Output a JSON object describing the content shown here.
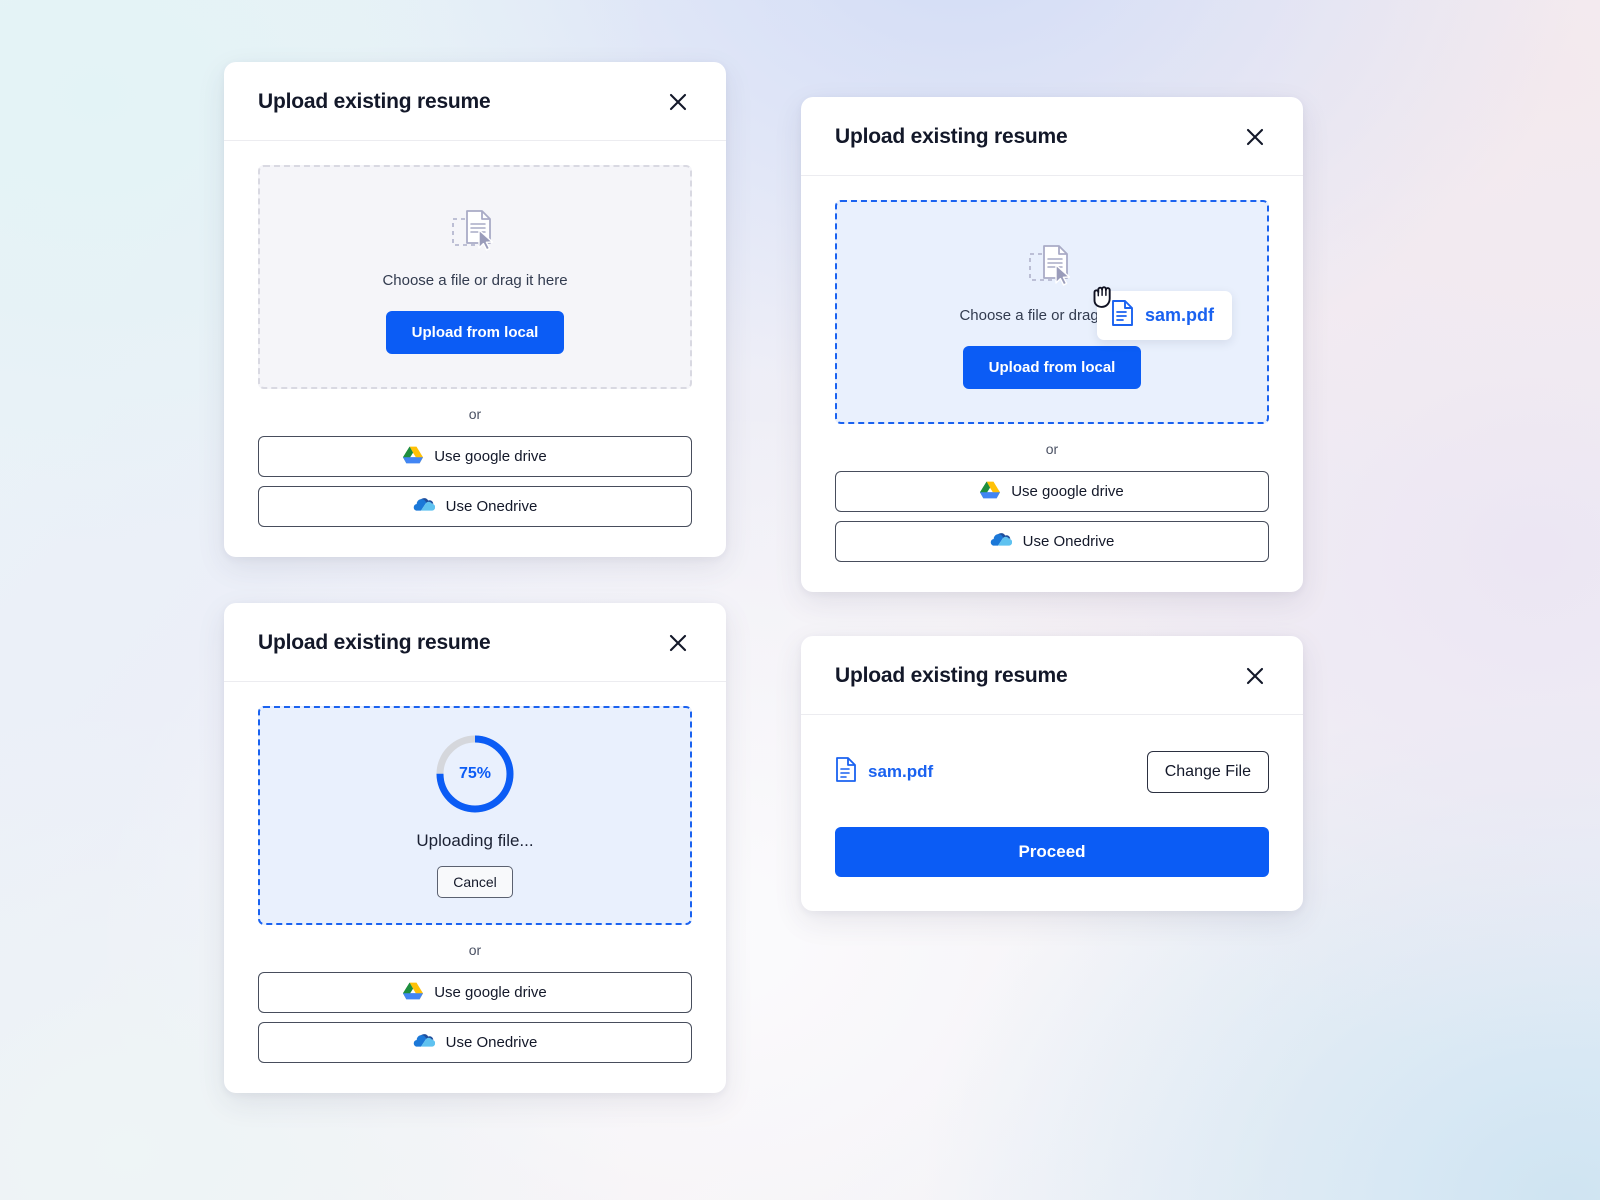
{
  "cards": {
    "initial": {
      "title": "Upload existing resume",
      "close_icon": "close-icon",
      "dropzone": {
        "icon": "file-drag-icon",
        "hint": "Choose a file or drag it here",
        "upload_button": "Upload from local",
        "state": "idle"
      },
      "separator": "or",
      "providers": [
        {
          "icon": "google-drive-icon",
          "label": "Use google drive"
        },
        {
          "icon": "onedrive-icon",
          "label": "Use Onedrive"
        }
      ]
    },
    "dragging": {
      "title": "Upload existing resume",
      "close_icon": "close-icon",
      "dropzone": {
        "icon": "file-drag-icon",
        "hint": "Choose a file or drag it here",
        "upload_button": "Upload from local",
        "state": "drag-active"
      },
      "drag_ghost": {
        "icon": "pdf-file-icon",
        "file_name": "sam.pdf",
        "cursor": "grabbing-hand-cursor"
      },
      "separator": "or",
      "providers": [
        {
          "icon": "google-drive-icon",
          "label": "Use google drive"
        },
        {
          "icon": "onedrive-icon",
          "label": "Use Onedrive"
        }
      ]
    },
    "uploading": {
      "title": "Upload existing resume",
      "close_icon": "close-icon",
      "progress": {
        "percent_label": "75%",
        "percent_value": 75,
        "status_text": "Uploading file...",
        "cancel_button": "Cancel"
      },
      "separator": "or",
      "providers": [
        {
          "icon": "google-drive-icon",
          "label": "Use google drive"
        },
        {
          "icon": "onedrive-icon",
          "label": "Use Onedrive"
        }
      ]
    },
    "selected": {
      "title": "Upload existing resume",
      "close_icon": "close-icon",
      "file": {
        "icon": "pdf-file-icon",
        "name": "sam.pdf"
      },
      "change_file_button": "Change File",
      "proceed_button": "Proceed"
    }
  },
  "colors": {
    "primary_blue": "#0b5cf5",
    "link_blue": "#1a62f0",
    "dropzone_idle_bg": "#f5f5f9",
    "dropzone_active_bg": "#e9f0fd",
    "dropzone_idle_border": "#d9d9e2",
    "dropzone_active_border": "#1a62f0",
    "title_color": "#131829",
    "ring_track": "#d5d7dc"
  }
}
